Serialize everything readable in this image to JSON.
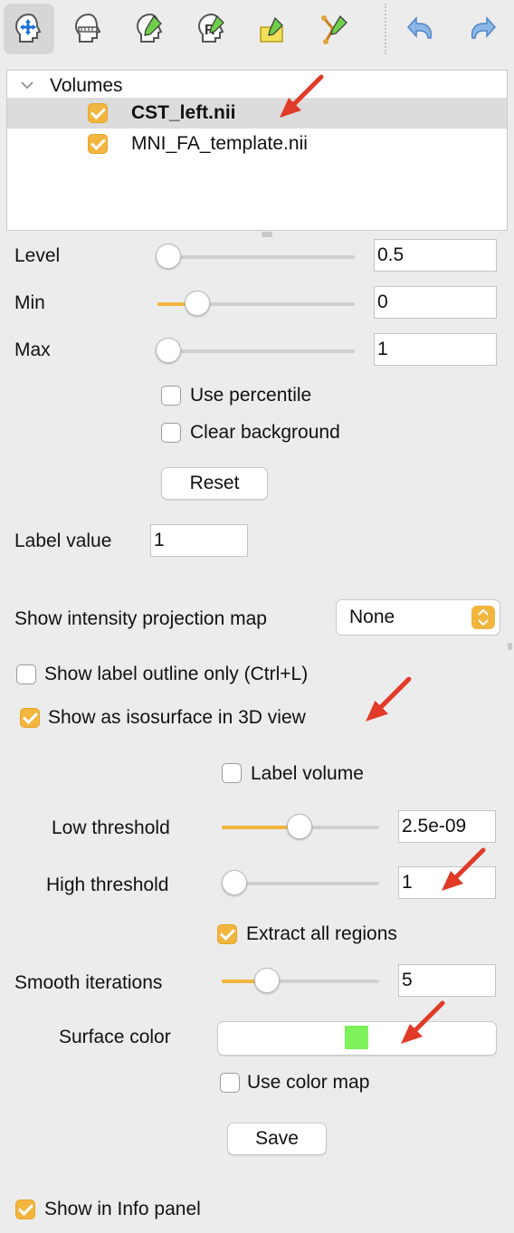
{
  "toolbar": {
    "icons": [
      "navigate-icon",
      "voxel-edit-icon",
      "recon-edit-icon",
      "roi-edit-icon",
      "point-set-edit-icon",
      "contour-icon",
      "undo-icon",
      "redo-icon"
    ]
  },
  "layers": {
    "header": "Volumes",
    "items": [
      {
        "name": "CST_left.nii",
        "checked": true,
        "selected": true
      },
      {
        "name": "MNI_FA_template.nii",
        "checked": true,
        "selected": false
      }
    ]
  },
  "controls": {
    "level_label": "Level",
    "level_value": "0.5",
    "level_slider": 0.0,
    "min_label": "Min",
    "min_value": "0",
    "min_slider": 0.2,
    "max_label": "Max",
    "max_value": "1",
    "max_slider": 0.0,
    "use_percentile": "Use percentile",
    "clear_background": "Clear background",
    "reset": "Reset",
    "label_value_label": "Label value",
    "label_value": "1",
    "projection_label": "Show intensity projection map",
    "projection_value": "None",
    "outline_only": "Show label outline only (Ctrl+L)",
    "isosurface": "Show as isosurface in 3D view",
    "label_volume": "Label volume",
    "low_threshold_label": "Low threshold",
    "low_threshold_value": "2.5e-09",
    "low_threshold_slider": 0.49,
    "high_threshold_label": "High threshold",
    "high_threshold_value": "1",
    "high_threshold_slider": 0.0,
    "extract_all_regions": "Extract all regions",
    "smooth_label": "Smooth iterations",
    "smooth_value": "5",
    "smooth_slider": 0.28,
    "surface_color_label": "Surface color",
    "surface_color": "#7ef25a",
    "use_color_map": "Use color map",
    "save": "Save",
    "show_info_panel": "Show in Info panel"
  },
  "colors": {
    "accent": "#f2b53e",
    "annotation_arrow": "#e03a28"
  }
}
